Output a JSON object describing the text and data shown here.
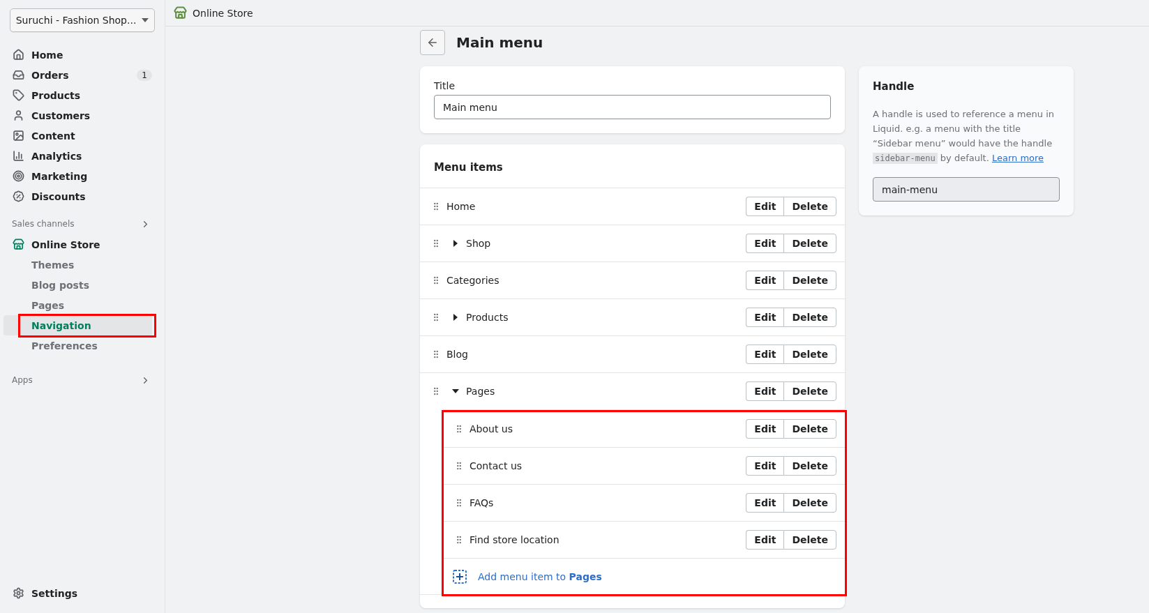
{
  "store_switcher": {
    "label": "Suruchi - Fashion Shop..."
  },
  "topbar": {
    "title": "Online Store"
  },
  "sidebar": {
    "items": [
      {
        "label": "Home",
        "selected": false
      },
      {
        "label": "Orders",
        "selected": false,
        "badge": "1"
      },
      {
        "label": "Products",
        "selected": false
      },
      {
        "label": "Customers",
        "selected": false
      },
      {
        "label": "Content",
        "selected": false
      },
      {
        "label": "Analytics",
        "selected": false
      },
      {
        "label": "Marketing",
        "selected": false
      },
      {
        "label": "Discounts",
        "selected": false
      }
    ],
    "sales_channels": {
      "heading": "Sales channels",
      "channel": {
        "label": "Online Store"
      },
      "sub_items": [
        {
          "label": "Themes",
          "selected": false,
          "highlighted": false
        },
        {
          "label": "Blog posts",
          "selected": false,
          "highlighted": false
        },
        {
          "label": "Pages",
          "selected": false,
          "highlighted": false
        },
        {
          "label": "Navigation",
          "selected": true,
          "highlighted": true
        },
        {
          "label": "Preferences",
          "selected": false,
          "highlighted": false
        }
      ]
    },
    "apps": {
      "heading": "Apps"
    },
    "settings": {
      "label": "Settings"
    }
  },
  "page": {
    "title": "Main menu"
  },
  "title_card": {
    "label": "Title",
    "value": "Main menu"
  },
  "menu_card": {
    "heading": "Menu items",
    "items": [
      {
        "label": "Home",
        "actions": [
          "Edit",
          "Delete"
        ]
      },
      {
        "label": "Shop",
        "expanded": false,
        "actions": [
          "Edit",
          "Delete"
        ]
      },
      {
        "label": "Categories",
        "actions": [
          "Edit",
          "Delete"
        ]
      },
      {
        "label": "Products",
        "expanded": false,
        "actions": [
          "Edit",
          "Delete"
        ]
      },
      {
        "label": "Blog",
        "actions": [
          "Edit",
          "Delete"
        ]
      },
      {
        "label": "Pages",
        "expanded": true,
        "highlighted": true,
        "actions": [
          "Edit",
          "Delete"
        ],
        "children": [
          {
            "label": "About us",
            "actions": [
              "Edit",
              "Delete"
            ]
          },
          {
            "label": "Contact us",
            "actions": [
              "Edit",
              "Delete"
            ]
          },
          {
            "label": "FAQs",
            "actions": [
              "Edit",
              "Delete"
            ]
          },
          {
            "label": "Find store location",
            "actions": [
              "Edit",
              "Delete"
            ]
          }
        ],
        "add_item": "Add menu item to **Pages**"
      }
    ]
  },
  "handle_card": {
    "heading": "Handle",
    "description": [
      {
        "kind": "text",
        "text": "A handle is used to reference a menu in Liquid. e.g. a menu with the title “Sidebar menu” would have the handle "
      },
      {
        "kind": "code",
        "text": "sidebar-menu"
      },
      {
        "kind": "text",
        "text": " by default. "
      },
      {
        "kind": "link",
        "text": "Learn more"
      }
    ],
    "value": "main-menu"
  }
}
